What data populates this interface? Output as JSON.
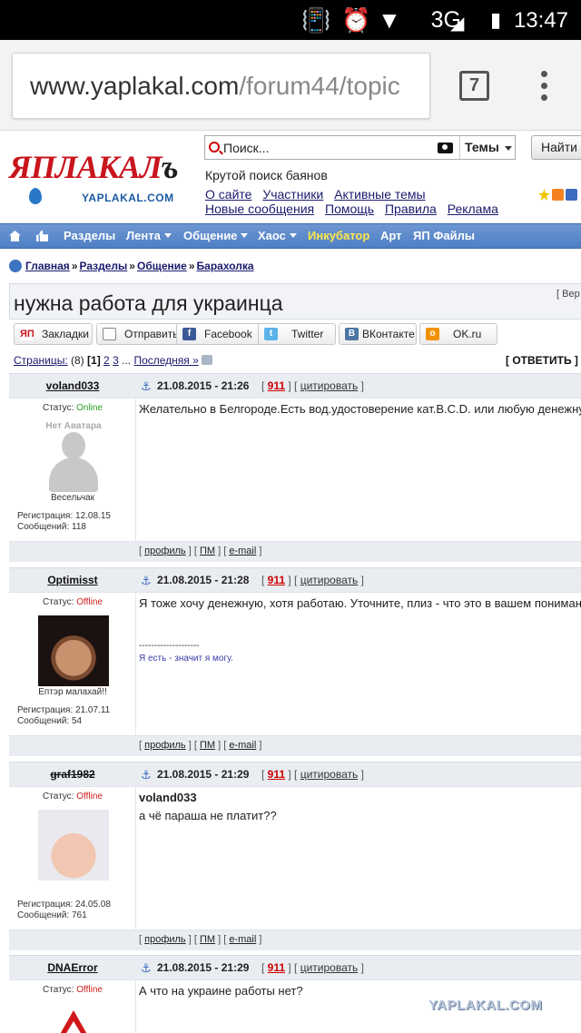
{
  "status_bar": {
    "network": "3G",
    "time": "13:47"
  },
  "browser": {
    "url_host": "www.yaplakal.com",
    "url_path": "/forum44/topic",
    "tab_count": "7"
  },
  "site": {
    "logo_main_red": "ЯПЛАКАЛ",
    "logo_main_dark": "ъ",
    "logo_sub": "YAPLAKAL.COM",
    "search_placeholder": "Поиск...",
    "search_scope": "Темы",
    "search_button": "Найти",
    "tagline": "Крутой поиск баянов",
    "links_row1": [
      "О сайте",
      "Участники",
      "Активные темы"
    ],
    "links_row2": [
      "Новые сообщения",
      "Помощь",
      "Правила",
      "Реклама"
    ]
  },
  "nav": {
    "items": [
      {
        "label": "Разделы",
        "dropdown": false,
        "highlight": false
      },
      {
        "label": "Лента",
        "dropdown": true,
        "highlight": false
      },
      {
        "label": "Общение",
        "dropdown": true,
        "highlight": false
      },
      {
        "label": "Хаос",
        "dropdown": true,
        "highlight": false
      },
      {
        "label": "Инкубатор",
        "dropdown": false,
        "highlight": true
      },
      {
        "label": "Арт",
        "dropdown": false,
        "highlight": false
      },
      {
        "label": "ЯП Файлы",
        "dropdown": false,
        "highlight": false
      }
    ]
  },
  "breadcrumb": [
    "Главная",
    "Разделы",
    "Общение",
    "Барахолка"
  ],
  "topic": {
    "title": "нужна работа для украинца",
    "version_link": "[ Вер"
  },
  "share": {
    "bookmarks": "Закладки",
    "send": "Отправить",
    "facebook": "Facebook",
    "twitter": "Twitter",
    "vk": "ВКонтакте",
    "ok": "OK.ru"
  },
  "pages": {
    "label": "Страницы:",
    "count": "(8)",
    "current": "[1]",
    "p2": "2",
    "p3": "3",
    "ellipsis": "...",
    "last": "Последняя »",
    "reply": "[ ОТВЕТИТЬ ] ["
  },
  "posts": [
    {
      "author": "voland033",
      "date": "21.08.2015 - 21:26",
      "num": "911",
      "cite": "цитировать",
      "status_label": "Статус:",
      "status": "Online",
      "avatar_text": "Нет Аватара",
      "rank": "Весельчак",
      "reg": "Регистрация: 12.08.15",
      "msgs": "Сообщений: 118",
      "text": "Желательно в Белгороде.Есть вод.удостоверение кат.B.C.D. или любую денежну",
      "quote_name": "",
      "sig_line": "",
      "sig_text": ""
    },
    {
      "author": "Optimisst",
      "date": "21.08.2015 - 21:28",
      "num": "911",
      "cite": "цитировать",
      "status_label": "Статус:",
      "status": "Offline",
      "avatar_text": "",
      "rank": "Ептэр малахай!!",
      "reg": "Регистрация: 21.07.11",
      "msgs": "Сообщений: 54",
      "text": "Я тоже хочу денежную, хотя работаю. Уточните, плиз - что это в вашем понимани",
      "quote_name": "",
      "sig_line": "--------------------",
      "sig_text": "Я есть - значит я могу."
    },
    {
      "author": "graf1982",
      "date": "21.08.2015 - 21:29",
      "num": "911",
      "cite": "цитировать",
      "status_label": "Статус:",
      "status": "Offline",
      "avatar_text": "",
      "rank": "",
      "reg": "Регистрация: 24.05.08",
      "msgs": "Сообщений: 761",
      "text": "а чё параша не платит??",
      "quote_name": "voland033",
      "sig_line": "",
      "sig_text": ""
    },
    {
      "author": "DNAError",
      "date": "21.08.2015 - 21:29",
      "num": "911",
      "cite": "цитировать",
      "status_label": "Статус:",
      "status": "Offline",
      "avatar_text": "",
      "rank": "",
      "reg": "",
      "msgs": "",
      "text": "А что на украине работы нет?",
      "quote_name": "",
      "sig_line": "",
      "sig_text": ""
    }
  ],
  "post_footer": {
    "profile": "профиль",
    "pm": "ПМ",
    "email": "e-mail"
  },
  "watermark": "YAPLAKAL.COM",
  "colors": {
    "nav_bg": "#5a88c9",
    "nav_highlight": "#ffe84a",
    "online": "#28a028",
    "offline": "#d02020",
    "logo_red": "#c9151e"
  }
}
